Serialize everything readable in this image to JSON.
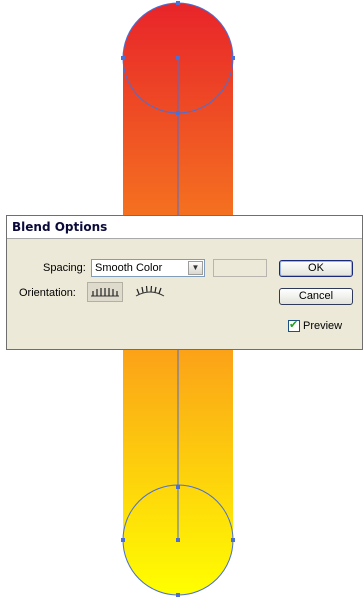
{
  "dialog": {
    "title": "Blend Options",
    "spacing_label": "Spacing:",
    "spacing_value": "Smooth Color",
    "orientation_label": "Orientation:",
    "ok_label": "OK",
    "cancel_label": "Cancel",
    "preview_label": "Preview",
    "preview_checked": true
  },
  "artwork": {
    "top_color": "#e8242a",
    "bottom_color": "#ffff00",
    "path_color": "#4a6fd6"
  }
}
